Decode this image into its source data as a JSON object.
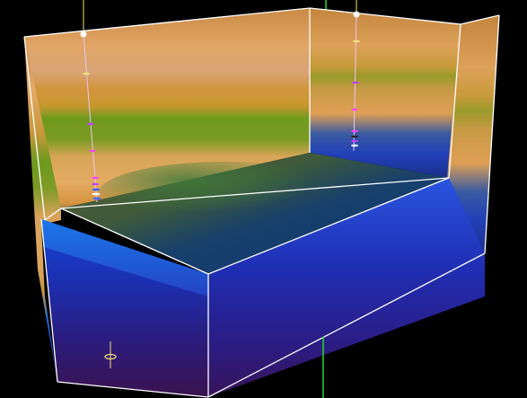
{
  "scene": {
    "background": "#000000",
    "edge_color": "#ffffff",
    "axis_color": "#22dd22",
    "well_color": "#f2e27a",
    "marker_colors": [
      "#c040ff",
      "#ff40ff",
      "#4060ff",
      "#ffffff",
      "#222222"
    ]
  }
}
